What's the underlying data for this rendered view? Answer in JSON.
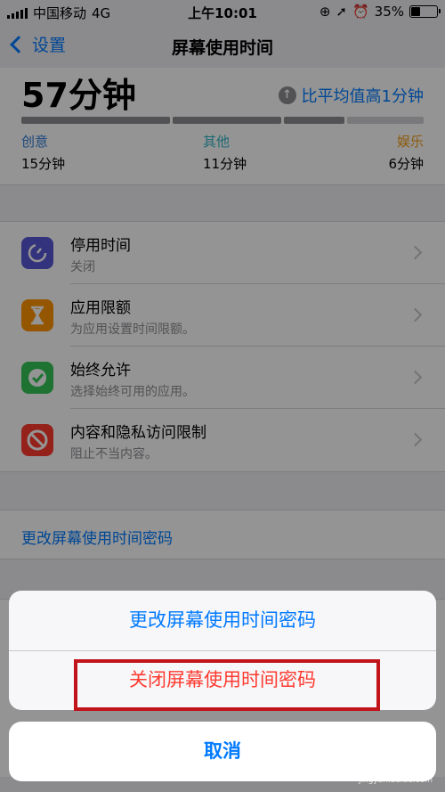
{
  "status_bar": {
    "carrier": "中国移动",
    "network": "4G",
    "time": "上午10:01",
    "battery": "35%",
    "battery_level": 0.35
  },
  "nav": {
    "back_label": "设置",
    "title": "屏幕使用时间"
  },
  "usage": {
    "total": "57分钟",
    "compare": "比平均值高1分钟",
    "categories": [
      {
        "name": "创意",
        "value": "15分钟",
        "color": "#2f7bd9",
        "fraction": 0.37
      },
      {
        "name": "其他",
        "value": "11分钟",
        "color": "#2fb5c6",
        "fraction": 0.27
      },
      {
        "name": "娱乐",
        "value": "6分钟",
        "color": "#f39c12",
        "fraction": 0.15
      }
    ]
  },
  "settings": [
    {
      "title": "停用时间",
      "subtitle": "关闭",
      "icon": "downtime-icon",
      "color": "#5856d6"
    },
    {
      "title": "应用限额",
      "subtitle": "为应用设置时间限额。",
      "icon": "hourglass-icon",
      "color": "#ff9500"
    },
    {
      "title": "始终允许",
      "subtitle": "选择始终可用的应用。",
      "icon": "checkmark-badge-icon",
      "color": "#34c759"
    },
    {
      "title": "内容和隐私访问限制",
      "subtitle": "阻止不当内容。",
      "icon": "prohibited-icon",
      "color": "#ff3b30"
    }
  ],
  "passcode_link": "更改屏幕使用时间密码",
  "action_sheet": {
    "change_passcode": "更改屏幕使用时间密码",
    "turn_off_passcode": "关闭屏幕使用时间密码",
    "cancel": "取消"
  },
  "watermark": {
    "text": "Bai 经验",
    "sub": "jingyan.baidu.com"
  }
}
